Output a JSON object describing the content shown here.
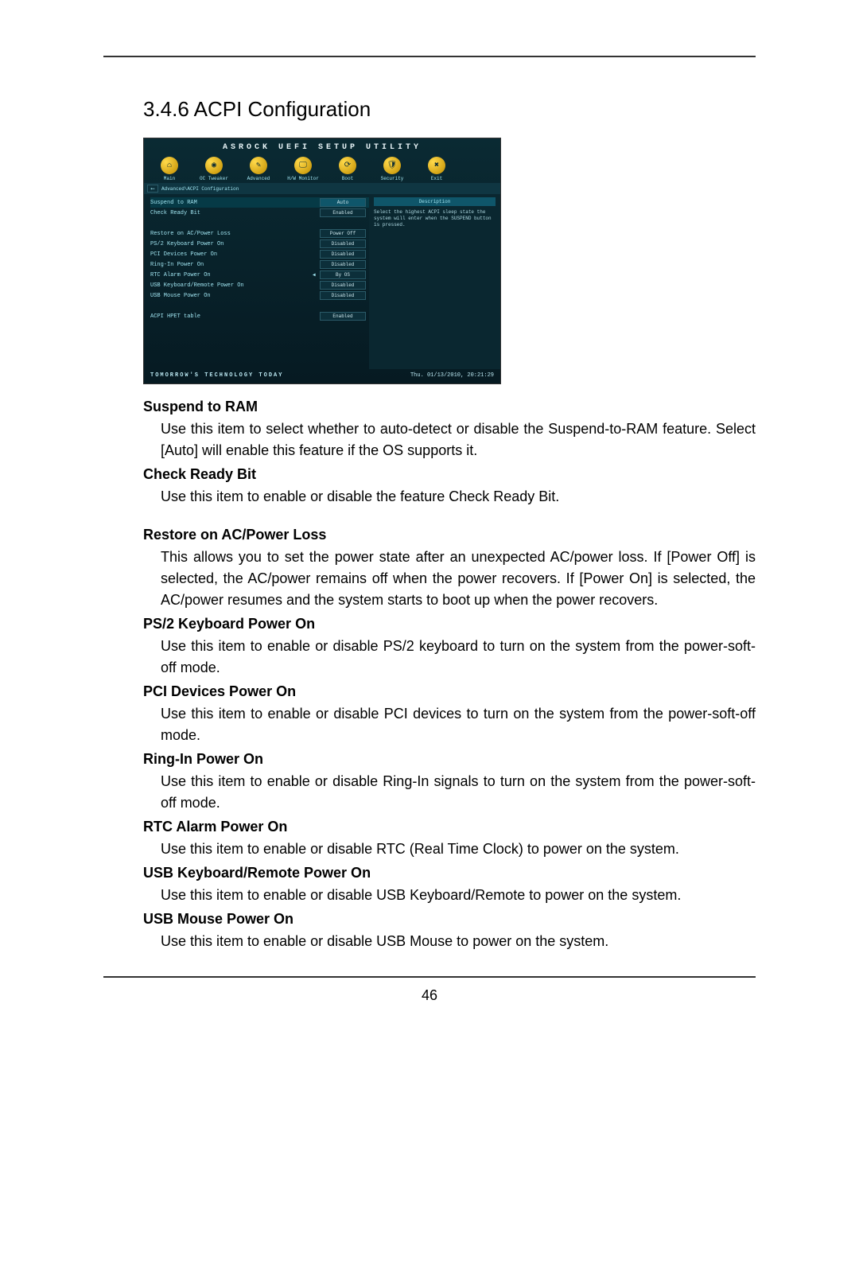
{
  "page_number": "46",
  "section_title": "3.4.6  ACPI Configuration",
  "bios": {
    "title": "ASROCK UEFI SETUP UTILITY",
    "tabs": [
      "Main",
      "OC Tweaker",
      "Advanced",
      "H/W Monitor",
      "Boot",
      "Security",
      "Exit"
    ],
    "tab_icons": [
      "⌂",
      "◉",
      "✎",
      "🖵",
      "⟳",
      "🛡",
      "✖"
    ],
    "breadcrumb": "Advanced\\ACPI Configuration",
    "rows": [
      {
        "label": "Suspend to RAM",
        "value": "Auto",
        "selected": true
      },
      {
        "label": "Check Ready Bit",
        "value": "Enabled"
      },
      {
        "label": "",
        "value": ""
      },
      {
        "label": "Restore on AC/Power Loss",
        "value": "Power Off"
      },
      {
        "label": "PS/2 Keyboard Power On",
        "value": "Disabled"
      },
      {
        "label": "PCI Devices Power On",
        "value": "Disabled"
      },
      {
        "label": "Ring-In Power On",
        "value": "Disabled"
      },
      {
        "label": "RTC Alarm Power On",
        "value": "By OS",
        "arrow": true
      },
      {
        "label": "USB Keyboard/Remote Power On",
        "value": "Disabled"
      },
      {
        "label": "USB Mouse Power On",
        "value": "Disabled"
      },
      {
        "label": "",
        "value": ""
      },
      {
        "label": "ACPI HPET table",
        "value": "Enabled"
      }
    ],
    "desc_title": "Description",
    "desc_text": "Select the highest ACPI sleep state the system will enter when the SUSPEND button is pressed.",
    "footer_left": "TOMORROW'S TECHNOLOGY TODAY",
    "footer_right": "Thu. 01/13/2010,  20:21:29"
  },
  "items": [
    {
      "title": "Suspend to RAM",
      "desc": "Use this item to select whether to auto-detect or disable the Suspend-to-RAM feature. Select [Auto] will enable this feature if the OS supports it."
    },
    {
      "title": "Check Ready Bit",
      "desc": "Use this item to enable or disable the feature Check Ready Bit."
    },
    {
      "gap": true
    },
    {
      "title": "Restore on AC/Power Loss",
      "desc": "This allows you to set the power state after an unexpected AC/power loss. If [Power Off] is selected, the AC/power remains off when the power recovers. If [Power On] is selected, the AC/power resumes and the system starts to boot up when the power recovers."
    },
    {
      "title": "PS/2 Keyboard Power On",
      "desc": "Use this item to enable or disable PS/2 keyboard to turn on the system from the power-soft-off mode."
    },
    {
      "title": "PCI Devices Power On",
      "desc": "Use this item to enable or disable PCI devices to turn on the system from the power-soft-off mode."
    },
    {
      "title": "Ring-In Power On",
      "desc": "Use this item to enable or disable Ring-In signals to turn on the system from the power-soft-off mode."
    },
    {
      "title": "RTC Alarm Power On",
      "desc": "Use this item to enable or disable RTC (Real Time Clock) to power on the system."
    },
    {
      "title": "USB Keyboard/Remote Power On",
      "desc": "Use this item to enable or disable USB Keyboard/Remote to power on the system."
    },
    {
      "title": "USB Mouse Power On",
      "desc": "Use this item to enable or disable USB Mouse to power on the system."
    }
  ]
}
